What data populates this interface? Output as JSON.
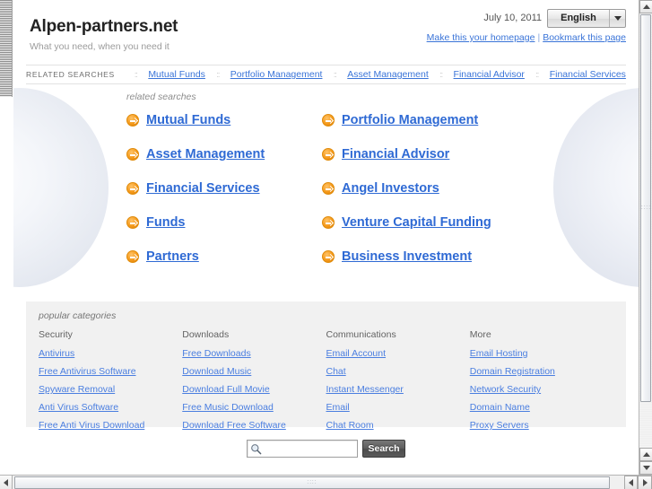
{
  "header": {
    "site_title": "Alpen-partners.net",
    "tagline": "What you need, when you need it",
    "date": "July 10, 2011",
    "language": "English",
    "homepage_link": "Make this your homepage",
    "separator": "|",
    "bookmark_link": "Bookmark this page"
  },
  "related_bar": {
    "label": "RELATED SEARCHES",
    "dots": "::",
    "items": [
      "Mutual Funds",
      "Portfolio Management",
      "Asset Management",
      "Financial Advisor",
      "Financial Services"
    ]
  },
  "hero": {
    "caption": "related searches",
    "links": [
      "Mutual Funds",
      "Portfolio Management",
      "Asset Management",
      "Financial Advisor",
      "Financial Services",
      "Angel Investors",
      "Funds",
      "Venture Capital Funding",
      "Partners",
      "Business Investment"
    ]
  },
  "popular": {
    "caption": "popular categories",
    "columns": [
      {
        "title": "Security",
        "links": [
          "Antivirus",
          "Free Antivirus Software",
          "Spyware Removal",
          "Anti Virus Software",
          "Free Anti Virus Download"
        ]
      },
      {
        "title": "Downloads",
        "links": [
          "Free Downloads",
          "Download Music",
          "Download Full Movie",
          "Free Music Download",
          "Download Free Software"
        ]
      },
      {
        "title": "Communications",
        "links": [
          "Email Account",
          "Chat",
          "Instant Messenger",
          "Email",
          "Chat Room"
        ]
      },
      {
        "title": "More",
        "links": [
          "Email Hosting",
          "Domain Registration",
          "Network Security",
          "Domain Name",
          "Proxy Servers"
        ]
      }
    ]
  },
  "search": {
    "value": "",
    "placeholder": "",
    "button_label": "Search"
  },
  "scrollbar": {
    "grip": "∷∷"
  },
  "colors": {
    "link_blue": "#3a74d8",
    "hero_link_blue": "#2f6ad4",
    "arrow_orange": "#f59a1b",
    "panel_grey": "#f1f1f1"
  }
}
